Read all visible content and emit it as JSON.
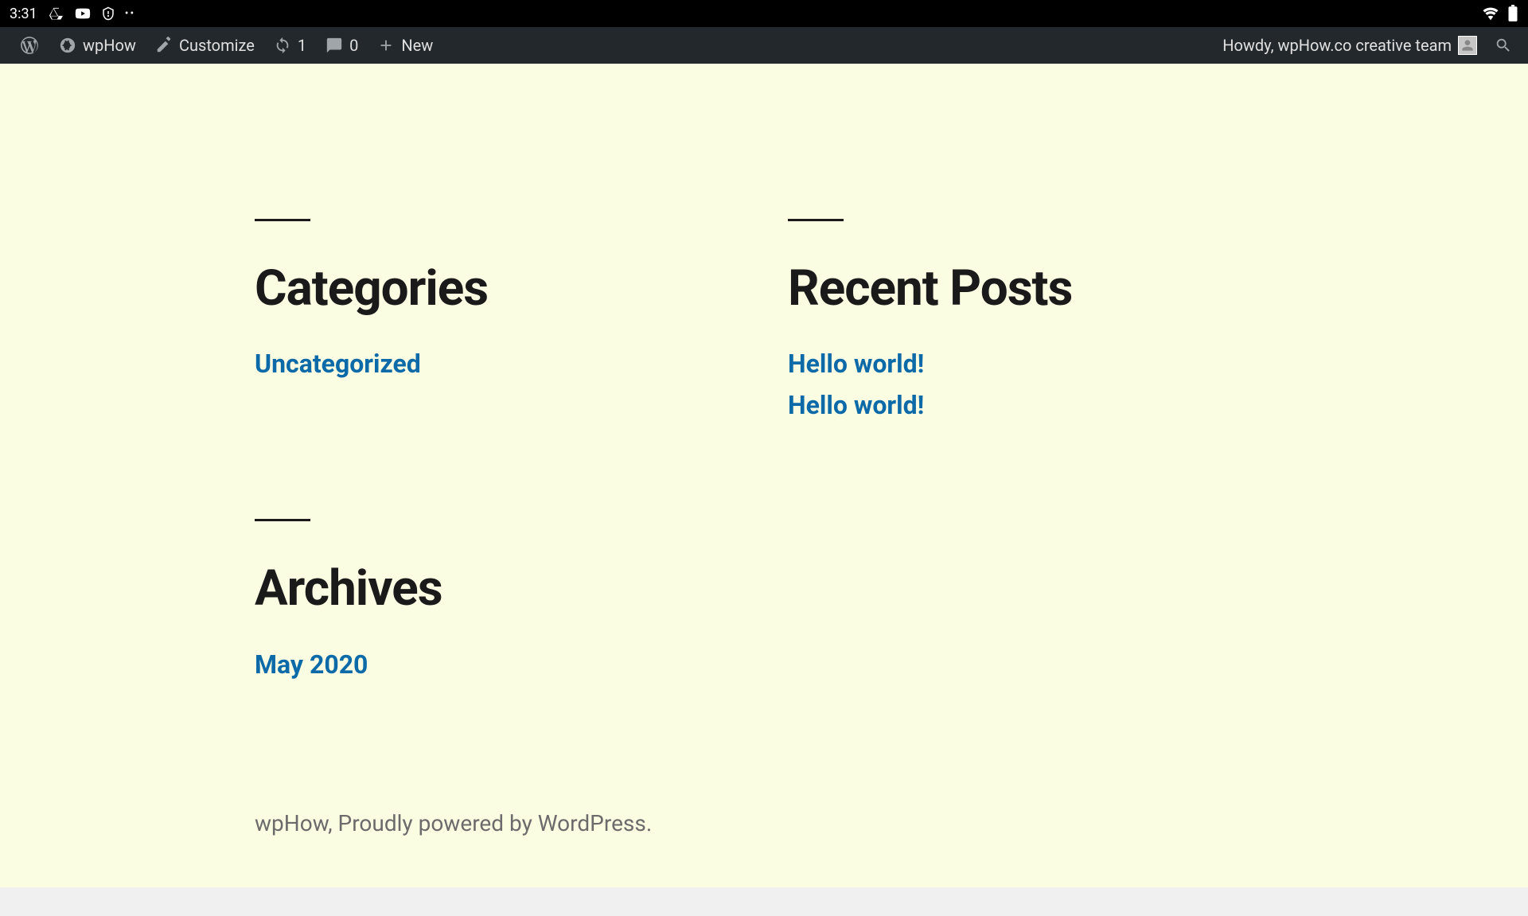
{
  "status_bar": {
    "time": "3:31"
  },
  "admin_bar": {
    "site_name": "wpHow",
    "customize_label": "Customize",
    "updates_count": "1",
    "comments_count": "0",
    "new_label": "New",
    "greeting": "Howdy, wpHow.co creative team"
  },
  "widgets": {
    "categories": {
      "title": "Categories",
      "items": [
        "Uncategorized"
      ]
    },
    "recent_posts": {
      "title": "Recent Posts",
      "items": [
        "Hello world!",
        "Hello world!"
      ]
    },
    "archives": {
      "title": "Archives",
      "items": [
        "May 2020"
      ]
    }
  },
  "footer": {
    "site_name": "wpHow",
    "separator": ", ",
    "credit_text": "Proudly powered by WordPress."
  }
}
